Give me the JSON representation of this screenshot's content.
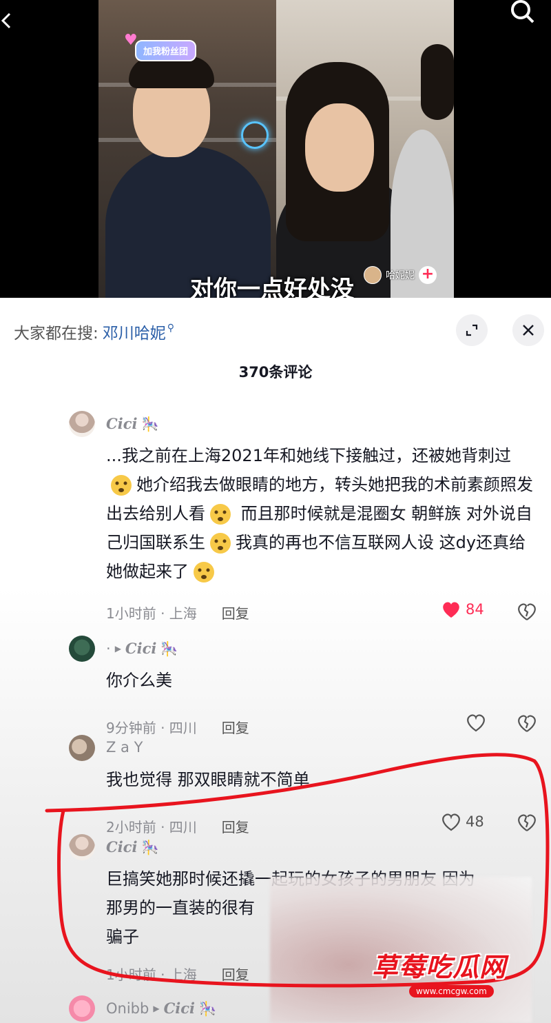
{
  "video": {
    "fan_badge": "加我粉丝团",
    "subtitle": "对你一点好处没",
    "streamer_name": "哈妮妮",
    "follow_symbol": "+"
  },
  "sheet": {
    "search_label": "大家都在搜:",
    "search_keyword": "邓川哈妮",
    "comment_count": "370条评论"
  },
  "comments": [
    {
      "username": "Cici",
      "text_parts": [
        "...我之前在上海2021年和她线下接触过，还被她背刺过",
        "她介绍我去做眼睛的地方，转头她把我的术前素颜照发出去给别人看",
        " 而且那时候就是混圈女 朝鲜族 对外说自己归国联系生",
        "我真的再也不信互联网人设 这dy还真给她做起来了"
      ],
      "time_location": "1小时前 · 上海",
      "reply": "回复",
      "likes": "84"
    },
    {
      "username_prefix": "·",
      "username": "Cici",
      "text": "你介么美",
      "time_location": "9分钟前 · 四川",
      "reply": "回复"
    },
    {
      "username": "Z a Y",
      "text": "我也觉得 那双眼睛就不简单",
      "time_location": "2小时前 · 四川",
      "reply": "回复",
      "likes": "48"
    },
    {
      "username": "Cici",
      "text_line1": "巨搞笑她那时候还撬一起玩的女孩子的男朋友 因为",
      "text_line2": "那男的一直装的很有",
      "text_line3": "骗子",
      "time_location": "1小时前 · 上海",
      "reply": "回复"
    },
    {
      "username": "Onibb",
      "reply_to": "Cici"
    }
  ],
  "watermark": {
    "title": "草莓吃瓜网",
    "url": "www.cmcgw.com"
  },
  "colors": {
    "accent_red": "#fe2c55",
    "link_blue": "#2b5fa8",
    "muted_text": "#8a8b91",
    "annotation_red": "#e8141e"
  },
  "icons": [
    "back-icon",
    "search-icon",
    "expand-icon",
    "close-icon",
    "heart-icon",
    "broken-heart-icon",
    "horse-icon",
    "emoji-icon"
  ]
}
